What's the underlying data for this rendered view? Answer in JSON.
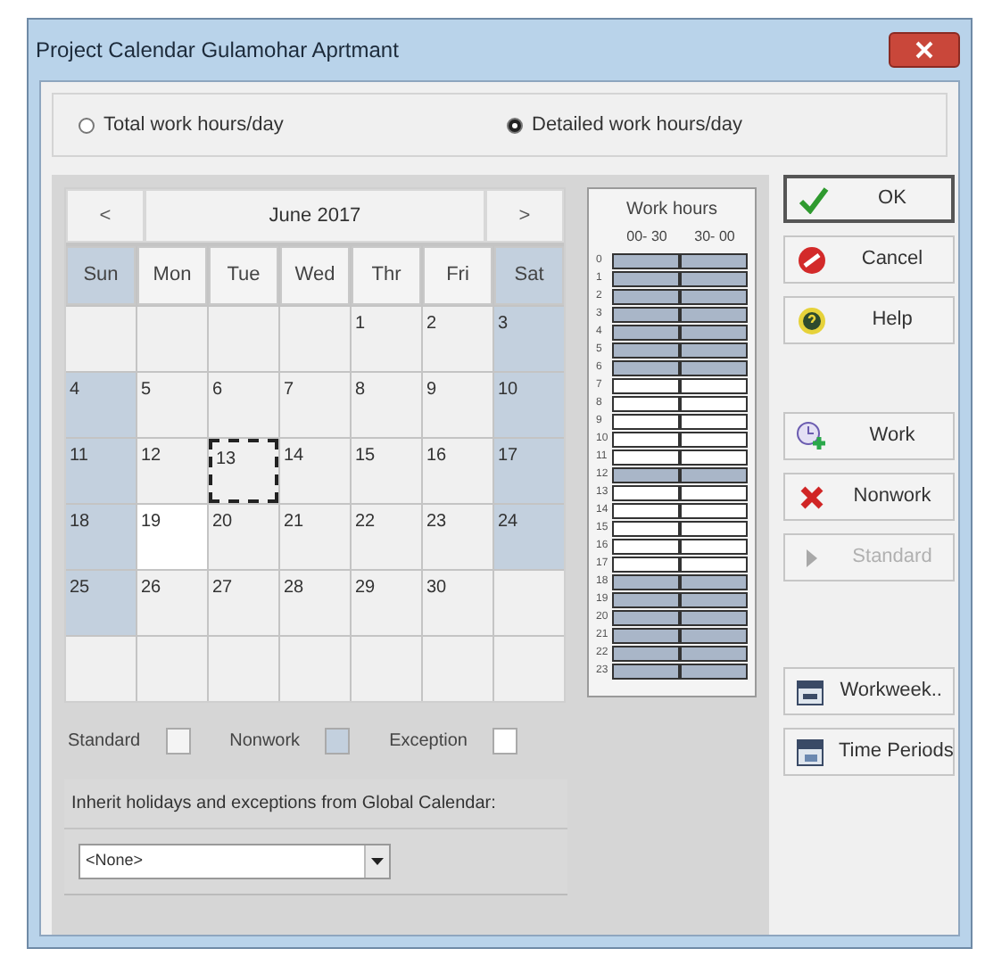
{
  "window": {
    "title": "Project Calendar Gulamohar Aprtmant"
  },
  "mode_options": [
    {
      "label": "Total work hours/day",
      "selected": false
    },
    {
      "label": "Detailed work hours/day",
      "selected": true
    }
  ],
  "calendar": {
    "prev": "<",
    "month": "June 2017",
    "next": ">",
    "weekdays": [
      {
        "label": "Sun",
        "weekend": true
      },
      {
        "label": "Mon",
        "weekend": false
      },
      {
        "label": "Tue",
        "weekend": false
      },
      {
        "label": "Wed",
        "weekend": false
      },
      {
        "label": "Thr",
        "weekend": false
      },
      {
        "label": "Fri",
        "weekend": false
      },
      {
        "label": "Sat",
        "weekend": true
      }
    ],
    "days": [
      {
        "kind": "empty",
        "selected": false
      },
      {
        "kind": "empty",
        "selected": false
      },
      {
        "kind": "empty",
        "selected": false
      },
      {
        "kind": "empty",
        "selected": false
      },
      {
        "day": "1",
        "kind": "standard",
        "selected": false
      },
      {
        "day": "2",
        "kind": "standard",
        "selected": false
      },
      {
        "day": "3",
        "kind": "nonwork",
        "selected": false
      },
      {
        "day": "4",
        "kind": "nonwork",
        "selected": false
      },
      {
        "day": "5",
        "kind": "standard",
        "selected": false
      },
      {
        "day": "6",
        "kind": "standard",
        "selected": false
      },
      {
        "day": "7",
        "kind": "standard",
        "selected": false
      },
      {
        "day": "8",
        "kind": "standard",
        "selected": false
      },
      {
        "day": "9",
        "kind": "standard",
        "selected": false
      },
      {
        "day": "10",
        "kind": "nonwork",
        "selected": false
      },
      {
        "day": "11",
        "kind": "nonwork",
        "selected": false
      },
      {
        "day": "12",
        "kind": "standard",
        "selected": false
      },
      {
        "day": "13",
        "kind": "standard",
        "selected": true
      },
      {
        "day": "14",
        "kind": "standard",
        "selected": false
      },
      {
        "day": "15",
        "kind": "standard",
        "selected": false
      },
      {
        "day": "16",
        "kind": "standard",
        "selected": false
      },
      {
        "day": "17",
        "kind": "nonwork",
        "selected": false
      },
      {
        "day": "18",
        "kind": "nonwork",
        "selected": false
      },
      {
        "day": "19",
        "kind": "exception",
        "selected": false
      },
      {
        "day": "20",
        "kind": "standard",
        "selected": false
      },
      {
        "day": "21",
        "kind": "standard",
        "selected": false
      },
      {
        "day": "22",
        "kind": "standard",
        "selected": false
      },
      {
        "day": "23",
        "kind": "standard",
        "selected": false
      },
      {
        "day": "24",
        "kind": "nonwork",
        "selected": false
      },
      {
        "day": "25",
        "kind": "nonwork",
        "selected": false
      },
      {
        "day": "26",
        "kind": "standard",
        "selected": false
      },
      {
        "day": "27",
        "kind": "standard",
        "selected": false
      },
      {
        "day": "28",
        "kind": "standard",
        "selected": false
      },
      {
        "day": "29",
        "kind": "standard",
        "selected": false
      },
      {
        "day": "30",
        "kind": "standard",
        "selected": false
      },
      {
        "kind": "empty",
        "selected": false
      },
      {
        "kind": "empty",
        "selected": false
      },
      {
        "kind": "empty",
        "selected": false
      },
      {
        "kind": "empty",
        "selected": false
      },
      {
        "kind": "empty",
        "selected": false
      },
      {
        "kind": "empty",
        "selected": false
      },
      {
        "kind": "empty",
        "selected": false
      },
      {
        "kind": "empty",
        "selected": false
      }
    ]
  },
  "work_hours": {
    "title": "Work hours",
    "columns": [
      "00- 30",
      "30- 00"
    ],
    "rows": [
      {
        "label": "0",
        "nonwork": true
      },
      {
        "label": "1",
        "nonwork": true
      },
      {
        "label": "2",
        "nonwork": true
      },
      {
        "label": "3",
        "nonwork": true
      },
      {
        "label": "4",
        "nonwork": true
      },
      {
        "label": "5",
        "nonwork": true
      },
      {
        "label": "6",
        "nonwork": true
      },
      {
        "label": "7",
        "nonwork": false
      },
      {
        "label": "8",
        "nonwork": false
      },
      {
        "label": "9",
        "nonwork": false
      },
      {
        "label": "10",
        "nonwork": false
      },
      {
        "label": "11",
        "nonwork": false
      },
      {
        "label": "12",
        "nonwork": true
      },
      {
        "label": "13",
        "nonwork": false
      },
      {
        "label": "14",
        "nonwork": false
      },
      {
        "label": "15",
        "nonwork": false
      },
      {
        "label": "16",
        "nonwork": false
      },
      {
        "label": "17",
        "nonwork": false
      },
      {
        "label": "18",
        "nonwork": true
      },
      {
        "label": "19",
        "nonwork": true
      },
      {
        "label": "20",
        "nonwork": true
      },
      {
        "label": "21",
        "nonwork": true
      },
      {
        "label": "22",
        "nonwork": true
      },
      {
        "label": "23",
        "nonwork": true
      }
    ]
  },
  "legend": [
    {
      "label": "Standard",
      "kind": "standard"
    },
    {
      "label": "Nonwork",
      "kind": "nonwork"
    },
    {
      "label": "Exception",
      "kind": "exception"
    }
  ],
  "inherit": {
    "label": "Inherit holidays and exceptions from Global Calendar:",
    "value": "<None>"
  },
  "buttons": [
    {
      "label": "OK",
      "kind": "ok",
      "disabled": false,
      "default": true
    },
    {
      "label": "Cancel",
      "kind": "cancel",
      "disabled": false,
      "default": false
    },
    {
      "label": "Help",
      "kind": "help",
      "disabled": false,
      "default": false
    },
    {
      "label": "Work",
      "kind": "work",
      "disabled": false,
      "default": false
    },
    {
      "label": "Nonwork",
      "kind": "nonwork",
      "disabled": false,
      "default": false
    },
    {
      "label": "Standard",
      "kind": "standard",
      "disabled": true,
      "default": false
    },
    {
      "label": "Workweek..",
      "kind": "workweek",
      "disabled": false,
      "default": false
    },
    {
      "label": "Time Periods",
      "kind": "periods",
      "disabled": false,
      "default": false
    }
  ]
}
